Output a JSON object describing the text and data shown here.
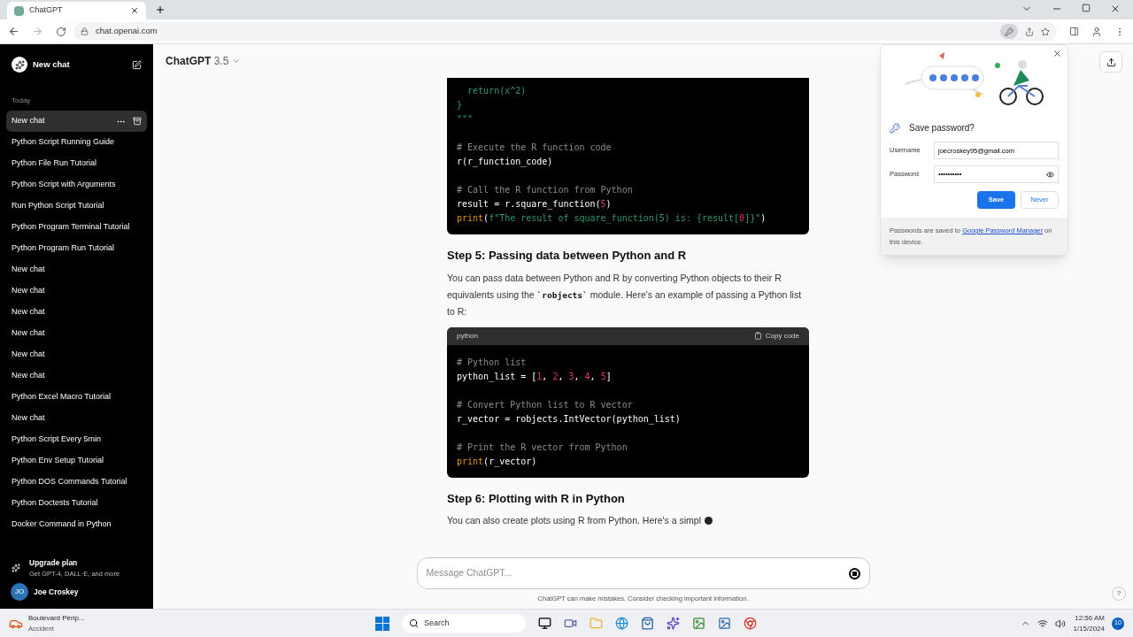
{
  "browser": {
    "tab_title": "ChatGPT",
    "url": "chat.openai.com"
  },
  "sidebar": {
    "new_chat": "New chat",
    "section": "Today",
    "items": [
      {
        "label": "New chat",
        "selected": true
      },
      {
        "label": "Python Script Running Guide",
        "selected": false
      },
      {
        "label": "Python File Run Tutorial",
        "selected": false
      },
      {
        "label": "Python Script with Arguments",
        "selected": false
      },
      {
        "label": "Run Python Script Tutorial",
        "selected": false
      },
      {
        "label": "Python Program Terminal Tutorial",
        "selected": false
      },
      {
        "label": "Python Program Run Tutorial",
        "selected": false
      },
      {
        "label": "New chat",
        "selected": false
      },
      {
        "label": "New chat",
        "selected": false
      },
      {
        "label": "New chat",
        "selected": false
      },
      {
        "label": "New chat",
        "selected": false
      },
      {
        "label": "New chat",
        "selected": false
      },
      {
        "label": "New chat",
        "selected": false
      },
      {
        "label": "Python Excel Macro Tutorial",
        "selected": false
      },
      {
        "label": "New chat",
        "selected": false
      },
      {
        "label": "Python Script Every 5min",
        "selected": false
      },
      {
        "label": "Python Env Setup Tutorial",
        "selected": false
      },
      {
        "label": "Python DOS Commands Tutorial",
        "selected": false
      },
      {
        "label": "Python Doctests Tutorial",
        "selected": false
      },
      {
        "label": "Docker Command in Python",
        "selected": false
      }
    ],
    "upgrade": {
      "title": "Upgrade plan",
      "subtitle": "Get GPT-4, DALL·E, and more"
    },
    "user": {
      "initials": "JO",
      "name": "Joe Croskey"
    }
  },
  "header": {
    "title": "ChatGPT",
    "version": "3.5"
  },
  "content": [
    {
      "kind": "code",
      "lines": [
        {
          "kind": "code",
          "segments": [
            {
              "text": "  return(x^2)",
              "kind": "string"
            }
          ]
        },
        {
          "kind": "code",
          "segments": [
            {
              "text": "}",
              "kind": "string"
            }
          ]
        },
        {
          "kind": "code",
          "segments": [
            {
              "text": "\"\"\"",
              "kind": "string"
            }
          ]
        },
        {
          "kind": "blank"
        },
        {
          "kind": "code",
          "segments": [
            {
              "text": "# Execute the R function code",
              "kind": "comment"
            }
          ]
        },
        {
          "kind": "code",
          "segments": [
            {
              "text": "r(r_function_code)",
              "kind": "plain"
            }
          ]
        },
        {
          "kind": "blank"
        },
        {
          "kind": "code",
          "segments": [
            {
              "text": "# Call the R function from Python",
              "kind": "comment"
            }
          ]
        },
        {
          "kind": "code",
          "segments": [
            {
              "text": "result = r.square_function(",
              "kind": "plain"
            },
            {
              "text": "5",
              "kind": "number"
            },
            {
              "text": ")",
              "kind": "plain"
            }
          ]
        },
        {
          "kind": "code",
          "segments": [
            {
              "text": "print",
              "kind": "keyword"
            },
            {
              "text": "(",
              "kind": "plain"
            },
            {
              "text": "f\"The result of square_function(5) is: {result[",
              "kind": "string"
            },
            {
              "text": "0",
              "kind": "number"
            },
            {
              "text": "]}\"",
              "kind": "string"
            },
            {
              "text": ")",
              "kind": "plain"
            }
          ]
        }
      ]
    },
    {
      "kind": "heading",
      "text": "Step 5: Passing data between Python and R"
    },
    {
      "kind": "paragraph",
      "segments": [
        {
          "text": "You can pass data between Python and R by converting Python objects to their R equivalents using the ",
          "kind": "text"
        },
        {
          "text": "`robjects`",
          "kind": "code"
        },
        {
          "text": " module. Here's an example of passing a Python list to R:",
          "kind": "text"
        }
      ]
    },
    {
      "kind": "code",
      "language": "python",
      "copy": "Copy code",
      "lines": [
        {
          "kind": "code",
          "segments": [
            {
              "text": "# Python list",
              "kind": "comment"
            }
          ]
        },
        {
          "kind": "code",
          "segments": [
            {
              "text": "python_list = [",
              "kind": "plain"
            },
            {
              "text": "1",
              "kind": "number"
            },
            {
              "text": ", ",
              "kind": "plain"
            },
            {
              "text": "2",
              "kind": "number"
            },
            {
              "text": ", ",
              "kind": "plain"
            },
            {
              "text": "3",
              "kind": "number"
            },
            {
              "text": ", ",
              "kind": "plain"
            },
            {
              "text": "4",
              "kind": "number"
            },
            {
              "text": ", ",
              "kind": "plain"
            },
            {
              "text": "5",
              "kind": "number"
            },
            {
              "text": "]",
              "kind": "plain"
            }
          ]
        },
        {
          "kind": "blank"
        },
        {
          "kind": "code",
          "segments": [
            {
              "text": "# Convert Python list to R vector",
              "kind": "comment"
            }
          ]
        },
        {
          "kind": "code",
          "segments": [
            {
              "text": "r_vector = robjects.IntVector(python_list)",
              "kind": "plain"
            }
          ]
        },
        {
          "kind": "blank"
        },
        {
          "kind": "code",
          "segments": [
            {
              "text": "# Print the R vector from Python",
              "kind": "comment"
            }
          ]
        },
        {
          "kind": "code",
          "segments": [
            {
              "text": "print",
              "kind": "keyword"
            },
            {
              "text": "(r_vector)",
              "kind": "plain"
            }
          ]
        }
      ]
    },
    {
      "kind": "heading",
      "text": "Step 6: Plotting with R in Python"
    },
    {
      "kind": "paragraph",
      "streaming": true,
      "segments": [
        {
          "text": "You can also create plots using R from Python. Here's a simpl",
          "kind": "text"
        }
      ]
    }
  ],
  "composer": {
    "placeholder": "Message ChatGPT...",
    "footnote": "ChatGPT can make mistakes. Consider checking important information.",
    "help": "?"
  },
  "password_popup": {
    "title": "Save password?",
    "username_label": "Username",
    "username": "joecroskey95@gmail.com",
    "password_label": "Password",
    "password": "••••••••••",
    "save": "Save",
    "never": "Never",
    "footer_before": "Passwords are saved to ",
    "footer_link": "Google Password Manager",
    "footer_after": " on this device."
  },
  "taskbar": {
    "weather_title": "Boulevard Périp...",
    "weather_subtitle": "Accident",
    "search": "Search",
    "time": "12:56 AM",
    "date": "1/15/2024",
    "notifications": "10"
  }
}
